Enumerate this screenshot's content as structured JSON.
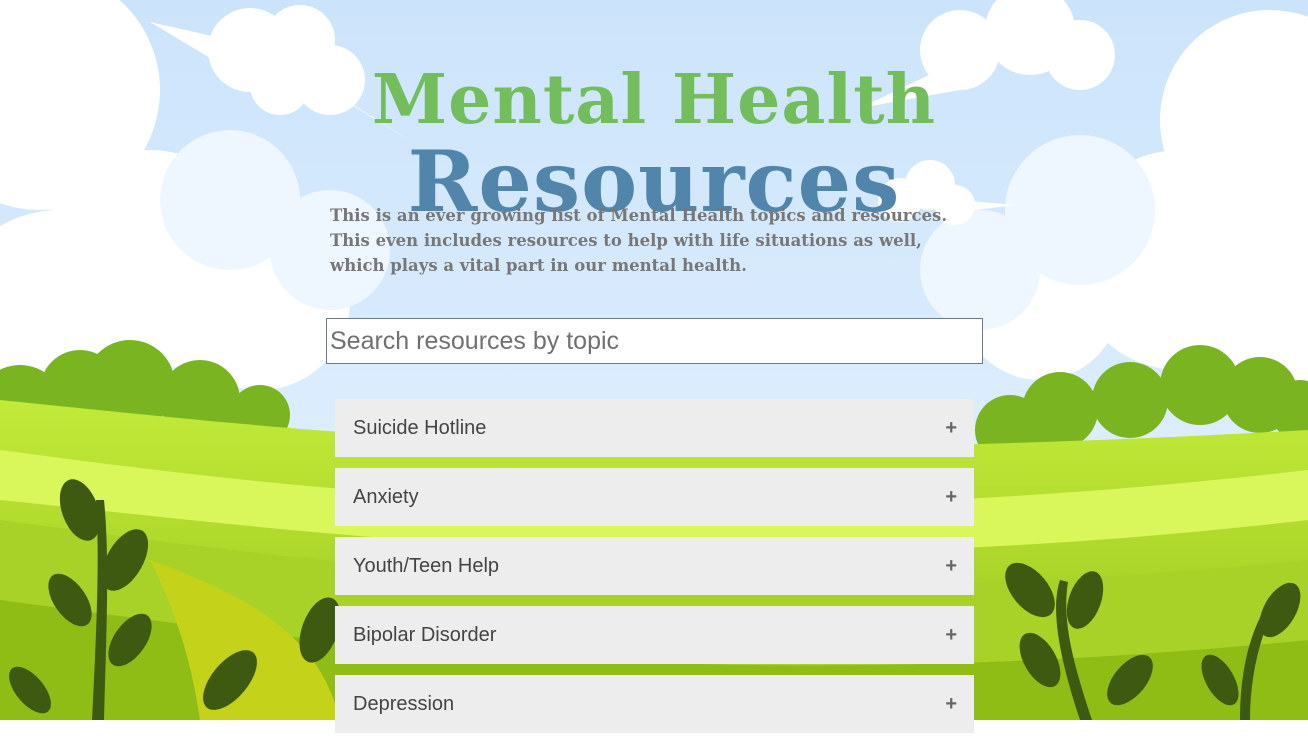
{
  "header": {
    "title_line1": "Mental Health",
    "title_line2": "Resources"
  },
  "intro": {
    "line1": "This is an ever growing list of Mental Health topics and resources.",
    "line2": "This even includes resources to help with life situations as well, which plays a vital part in our mental health."
  },
  "search": {
    "placeholder": "Search resources by topic",
    "value": ""
  },
  "accordion": {
    "expand_icon": "plus-icon",
    "items": [
      {
        "label": "Suicide Hotline",
        "icon": "+"
      },
      {
        "label": "Anxiety",
        "icon": "+"
      },
      {
        "label": "Youth/Teen Help",
        "icon": "+"
      },
      {
        "label": "Bipolar Disorder",
        "icon": "+"
      },
      {
        "label": "Depression",
        "icon": "+"
      }
    ]
  },
  "colors": {
    "title_green": "#74bd5d",
    "title_blue": "#5185ab",
    "intro_text": "#777777",
    "accordion_bg": "#ededed",
    "accordion_text": "#444444",
    "sky": "#cfe6fb",
    "grass": "#9ccc1e"
  }
}
